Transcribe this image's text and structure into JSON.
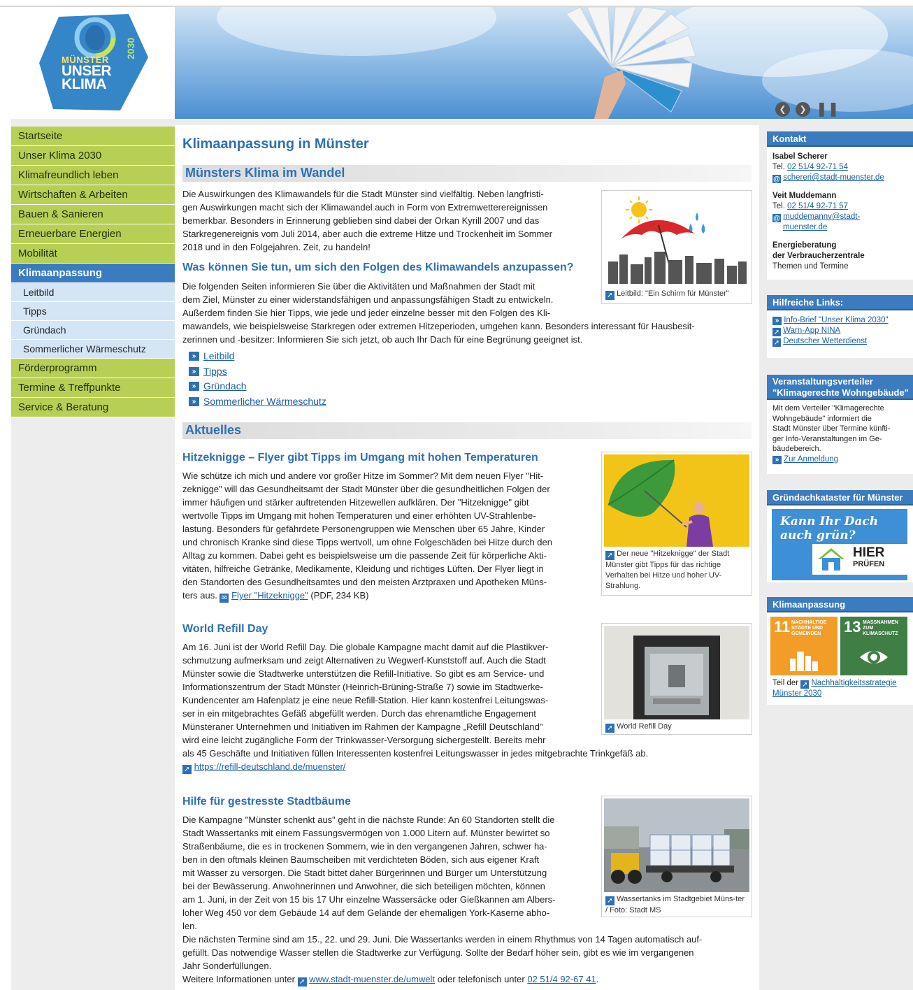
{
  "logo": {
    "line1": "MÜNSTER",
    "line2": "UNSER",
    "line3": "KLIMA",
    "year": "2030"
  },
  "banner": {
    "prev_icon": "chevron-left-icon",
    "next_icon": "chevron-right-icon",
    "pause_icon": "pause-icon"
  },
  "nav": {
    "items": [
      {
        "label": "Startseite"
      },
      {
        "label": "Unser Klima 2030"
      },
      {
        "label": "Klimafreundlich leben"
      },
      {
        "label": "Wirtschaften & Arbeiten"
      },
      {
        "label": "Bauen & Sanieren"
      },
      {
        "label": "Erneuerbare Energien"
      },
      {
        "label": "Mobilität"
      },
      {
        "label": "Klimaanpassung"
      },
      {
        "label": "Förderprogramm"
      },
      {
        "label": "Termine & Treffpunkte"
      },
      {
        "label": "Service & Beratung"
      }
    ],
    "subitems": [
      {
        "label": "Leitbild"
      },
      {
        "label": "Tipps"
      },
      {
        "label": "Gründach"
      },
      {
        "label": "Sommerlicher Wärmeschutz"
      }
    ]
  },
  "main": {
    "title": "Klimaanpassung in Münster",
    "section1": "Münsters Klima im Wandel",
    "intro": [
      "Die Auswirkungen des Klimawandels für die Stadt Münster sind vielfältig. Neben langfristi-",
      "gen Auswirkungen macht sich der Klimawandel auch in Form von Extremwetterereignissen",
      "bemerkbar. Besonders in Erinnerung geblieben sind dabei der Orkan Kyrill 2007 und das",
      "Starkregenereignis vom Juli 2014, aber auch die extreme Hitze und Trockenheit im Sommer",
      "2018 und in den Folgejahren. Zeit, zu handeln!"
    ],
    "subheading": "Was können Sie tun, um sich den Folgen des Klimawandels anzupassen?",
    "body2": [
      "Die folgenden Seiten informieren Sie über die Aktivitäten und Maßnahmen der Stadt mit",
      "dem Ziel, Münster zu einer widerstandsfähigen und anpassungsfähigen Stadt zu entwickeln.",
      "Außerdem finden Sie hier Tipps, wie jede und jeder einzelne besser mit den Folgen des Kli-",
      "mawandels, wie beispielsweise Starkregen oder extremen Hitzeperioden, umgehen kann. Besonders interessant für Hausbesit-",
      "zerinnen und -besitzer: Informieren Sie sich jetzt, ob auch Ihr Dach für eine Begrünung geeignet ist."
    ],
    "links": [
      "Leitbild",
      "Tipps",
      "Gründach",
      "Sommerlicher Wärmeschutz"
    ],
    "leitbild_caption": "Leitbild: \"Ein Schirm für Münster\"",
    "section2": "Aktuelles",
    "news1": {
      "title": "Hitzeknigge – Flyer gibt Tipps im Umgang mit hohen Temperaturen",
      "lines": [
        "Wie schütze ich mich und andere vor großer Hitze im Sommer? Mit dem neuen Flyer \"Hit-",
        "zeknigge\" will das Gesundheitsamt der Stadt Münster über die gesundheitlichen Folgen der",
        "immer häufigen und stärker auftretenden Hitzewellen aufklären. Der \"Hitzeknigge\" gibt",
        "wertvolle Tipps im Umgang mit hohen Temperaturen und einer erhöhten UV-Strahlenbe-",
        "lastung. Besonders für gefährdete Personengruppen wie Menschen über 65 Jahre, Kinder",
        "und chronisch Kranke sind diese Tipps wertvoll, um ohne Folgeschäden bei Hitze durch den",
        "Alltag zu kommen. Dabei geht es beispielsweise um die passende Zeit für körperliche Akti-",
        "vitäten, hilfreiche Getränke, Medikamente, Kleidung und richtiges Lüften. Der Flyer liegt in",
        "den Standorten des Gesundheitsamtes und den meisten Arztpraxen und Apotheken Müns-"
      ],
      "last_line_prefix": "ters aus.",
      "flyer_link": "Flyer \"Hitzeknigge\"",
      "flyer_info": "(PDF, 234 KB)",
      "caption": "Der neue \"Hitzeknigge\" der Stadt Münster gibt Tipps für das richtige Verhalten bei Hitze und hoher UV-Strahlung."
    },
    "news2": {
      "title": "World Refill Day",
      "lines": [
        "Am 16. Juni ist der World Refill Day. Die globale Kampagne macht damit auf die Plastikver-",
        "schmutzung aufmerksam und zeigt Alternativen zu Wegwerf-Kunststoff auf. Auch die Stadt",
        "Münster sowie die Stadtwerke unterstützen die Refill-Initiative. So gibt es am Service- und",
        "Informationszentrum der Stadt Münster (Heinrich-Brüning-Straße 7) sowie im Stadtwerke-",
        "Kundencenter am Hafenplatz je eine neue Refill-Station. Hier kann kostenfrei Leitungswas-",
        "ser in ein mitgebrachtes Gefäß abgefüllt werden. Durch das ehrenamtliche Engagement",
        "Münsteraner Unternehmen und Initiativen im Rahmen der Kampagne „Refill Deutschland\"",
        "wird eine leicht zugängliche Form der Trinkwasser-Versorgung sichergestellt. Bereits mehr",
        "als 45 Geschäfte und Initiativen füllen Interessenten kostenfrei Leitungswasser in jedes mitgebrachte Trinkgefäß ab."
      ],
      "link": "https://refill-deutschland.de/muenster/",
      "caption": "World Refill Day"
    },
    "news3": {
      "title": "Hilfe für gestresste Stadtbäume",
      "lines": [
        "Die Kampagne \"Münster schenkt aus\" geht in die nächste Runde: An 60 Standorten stellt die",
        "Stadt Wassertanks mit einem Fassungsvermögen von 1.000 Litern auf. Münster bewirtet so",
        "Straßenbäume, die es in trockenen Sommern, wie in den vergangenen Jahren, schwer ha-",
        "ben in den oftmals kleinen Baumscheiben mit verdichteten Böden, sich aus eigener Kraft",
        "mit Wasser zu versorgen. Die Stadt bittet daher Bürgerinnen und Bürger um Unterstützung",
        "bei der Bewässerung. Anwohnerinnen und Anwohner, die sich beteiligen möchten, können",
        "am 1. Juni, in der Zeit von 15 bis 17 Uhr einzelne Wassersäcke oder Gießkannen am Albers-",
        "loher Weg 450 vor dem Gebäude 14 auf dem Gelände der ehemaligen York-Kaserne abho-",
        "len.",
        "Die nächsten Termine sind am 15., 22. und 29. Juni. Die Wassertanks werden in einem Rhythmus von 14 Tagen automatisch auf-",
        "gefüllt. Das notwendige Wasser stellen die Stadtwerke zur Verfügung. Sollte der Bedarf höher sein, gibt es wie im vergangenen",
        "Jahr Sonderfüllungen."
      ],
      "more_prefix": "Weitere Informationen unter",
      "more_link": "www.stadt-muenster.de/umwelt",
      "more_mid": "oder telefonisch unter",
      "phone": "02 51/4 92-67 41",
      "more_end": ".",
      "caption": "Wassertanks im Stadtgebiet Müns-ter / Foto: Stadt MS"
    }
  },
  "sidebar": {
    "kontakt": {
      "title": "Kontakt",
      "p1_name": "Isabel Scherer",
      "p1_tel_label": "Tel.",
      "p1_tel": "02 51/4 92-71 54",
      "p1_mail": "schereri@stadt-muenster.de",
      "p2_name": "Veit Muddemann",
      "p2_tel_label": "Tel.",
      "p2_tel": "02 51/4 92-71 57",
      "p2_mail_1": "muddemannv@stadt-",
      "p2_mail_2": "muenster.de",
      "energy_1": "Energieberatung",
      "energy_2": "der Verbraucherzentrale",
      "energy_3": "Themen und Termine"
    },
    "links": {
      "title": "Hilfreiche Links:",
      "items": [
        "Info-Brief \"Unser Klima 2030\"",
        "Warn-App NINA",
        "Deutscher Wetterdienst"
      ]
    },
    "verteiler": {
      "title_1": "Veranstaltungsverteiler",
      "title_2": "\"Klimagerechte Wohngebäude\"",
      "text": [
        "Mit dem Verteiler \"Klimagerechte",
        "Wohngebäude\" informiert die",
        "Stadt Münster über Termine künfti-",
        "ger Info-Veranstaltungen im Ge-",
        "bäudebereich."
      ],
      "link": "Zur Anmeldung"
    },
    "kataster": {
      "title": "Gründachkataster für Münster",
      "slogan_1": "Kann Ihr Dach",
      "slogan_2": "auch grün?",
      "hier": "HIER",
      "pruefen": "PRÜFEN"
    },
    "klima": {
      "title": "Klimaanpassung",
      "sdg11_num": "11",
      "sdg11_text_1": "NACHHALTIGE",
      "sdg11_text_2": "STÄDTE UND",
      "sdg11_text_3": "GEMEINDEN",
      "sdg13_num": "13",
      "sdg13_text_1": "MASSNAHMEN ZUM",
      "sdg13_text_2": "KLIMASCHUTZ",
      "footer_prefix": "Teil der",
      "footer_link_1": "Nachhaltigkeitsstrategie",
      "footer_link_2": "Münster 2030"
    }
  },
  "colors": {
    "nav_green": "#b8cf55",
    "nav_active": "#3b7bbf",
    "sub_blue": "#d4e6f6",
    "heading_blue": "#2d70b6",
    "sdg11": "#f39d29",
    "sdg13": "#3f7e44"
  }
}
